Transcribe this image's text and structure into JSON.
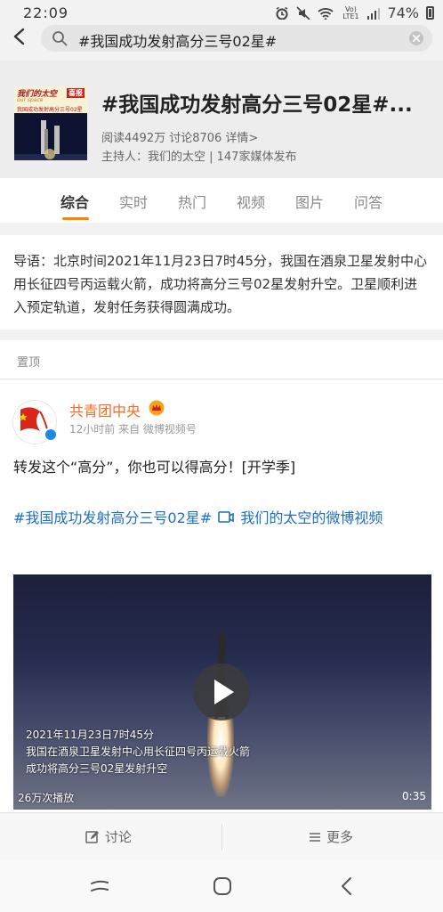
{
  "status_bar": {
    "time": "22:09",
    "network": "Vo) LTE1",
    "battery": "74%"
  },
  "search": {
    "query": "#我国成功发射高分三号02星#"
  },
  "topic": {
    "cover": {
      "brand": "我们的太空",
      "badge": "喜报",
      "subtitle": "our space",
      "line": "我国成功发射高分三号02星"
    },
    "title": "#我国成功发射高分三号02星#...",
    "stats": "阅读4492万 讨论8706 详情>",
    "host": "主持人：我们的太空 | 147家媒体发布"
  },
  "tabs": [
    {
      "label": "综合"
    },
    {
      "label": "实时"
    },
    {
      "label": "热门"
    },
    {
      "label": "视频"
    },
    {
      "label": "图片"
    },
    {
      "label": "问答"
    }
  ],
  "intro": {
    "text": "导语：北京时间2021年11月23日7时45分，我国在酒泉卫星发射中心用长征四号丙运载火箭，成功将高分三号02星发射升空。卫星顺利进入预定轨道，发射任务获得圆满成功。"
  },
  "pinned_label": "置顶",
  "post": {
    "author": "共青团中央",
    "meta": "12小时前 来自 微博视频号",
    "text": "转发这个“高分”，你也可以得高分！[开学季]",
    "hashtag": "#我国成功发射高分三号02星#",
    "video_link": "我们的太空的微博视频",
    "video": {
      "caption_date": "2021年11月23日7时45分",
      "caption_line2": "我国在酒泉卫星发射中心用长征四号丙运载火箭",
      "caption_line3": "成功将高分三号02星发射升空",
      "views": "26万次播放",
      "duration": "0:35"
    }
  },
  "actions": {
    "discuss": "讨论",
    "more": "更多"
  },
  "colors": {
    "accent": "#ff8200",
    "link": "#1e6fc2",
    "author": "#f86b22"
  }
}
